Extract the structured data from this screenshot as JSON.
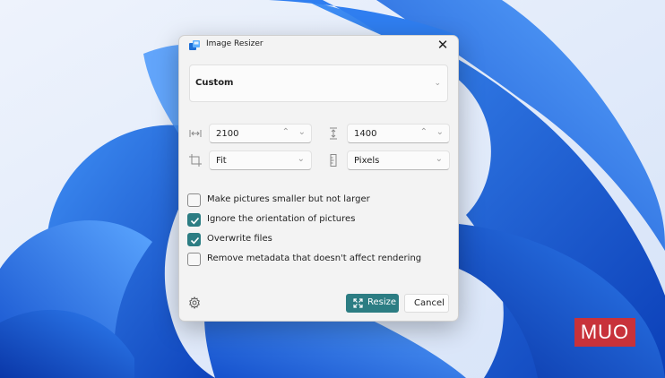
{
  "window": {
    "title": "Image Resizer"
  },
  "preset": {
    "selected": "Custom"
  },
  "size": {
    "width": "2100",
    "height": "1400",
    "fit": "Fit",
    "unit": "Pixels"
  },
  "options": [
    {
      "label": "Make pictures smaller but not larger",
      "checked": false
    },
    {
      "label": "Ignore the orientation of pictures",
      "checked": true
    },
    {
      "label": "Overwrite files",
      "checked": true
    },
    {
      "label": "Remove metadata that doesn't affect rendering",
      "checked": false
    }
  ],
  "buttons": {
    "resize": "Resize",
    "cancel": "Cancel"
  },
  "watermark": "MUO",
  "colors": {
    "accent": "#2c7d83",
    "wallpaper": "#1a5fd8"
  },
  "icons": {
    "app": "image-resizer-app-icon",
    "close": "close-icon",
    "width": "width-arrows-icon",
    "height": "height-arrows-icon",
    "crop": "crop-icon",
    "unit": "ruler-icon",
    "settings": "gear-icon",
    "resize": "resize-arrows-icon"
  }
}
